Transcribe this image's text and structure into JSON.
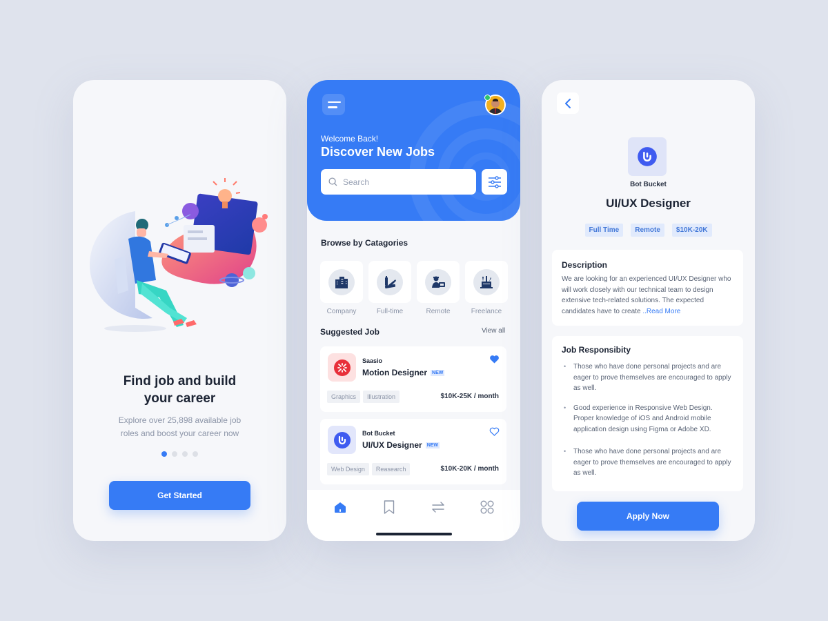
{
  "onboarding": {
    "title": "Find job and build your career",
    "subtitle": "Explore over 25,898 available job roles and boost your career now",
    "pagination": {
      "total": 4,
      "active": 1
    },
    "cta_label": "Get Started"
  },
  "home": {
    "welcome": "Welcome Back!",
    "heading": "Discover New Jobs",
    "search": {
      "placeholder": "Search",
      "value": ""
    },
    "categories_title": "Browse by Catagories",
    "categories": [
      {
        "label": "Company",
        "icon": "building-icon"
      },
      {
        "label": "Full-time",
        "icon": "tools-icon"
      },
      {
        "label": "Remote",
        "icon": "remote-worker-icon"
      },
      {
        "label": "Freelance",
        "icon": "pen-holder-icon"
      }
    ],
    "suggested_title": "Suggested Job",
    "view_all_label": "View all",
    "jobs": [
      {
        "company": "Saasio",
        "title": "Motion Designer",
        "badge": "NEW",
        "tags": [
          "Graphics",
          "Illustration"
        ],
        "salary": "$10K-25K / month",
        "favorited": true,
        "logo_color": "#e8303a",
        "logo_bg": "#fde1e1"
      },
      {
        "company": "Bot Bucket",
        "title": "UI/UX Designer",
        "badge": "NEW",
        "tags": [
          "Web Design",
          "Reasearch"
        ],
        "salary": "$10K-20K / month",
        "favorited": false,
        "logo_color": "#3f5bf0",
        "logo_bg": "#e2e6fb"
      }
    ],
    "nav": [
      {
        "name": "home",
        "icon": "home-icon",
        "active": true
      },
      {
        "name": "saved",
        "icon": "bookmark-icon",
        "active": false
      },
      {
        "name": "transfer",
        "icon": "swap-arrows-icon",
        "active": false
      },
      {
        "name": "more",
        "icon": "grid-icon",
        "active": false
      }
    ]
  },
  "detail": {
    "company": "Bot Bucket",
    "title": "UI/UX Designer",
    "tags": [
      "Full Time",
      "Remote",
      "$10K-20K"
    ],
    "description_title": "Description",
    "description": "We are looking for an experienced UI/UX Designer who will work closely with our technical team to design extensive tech-related solutions. The expected candidates have to create ",
    "read_more_label": "..Read More",
    "responsibility_title": "Job Responsibity",
    "responsibilities": [
      "Those who have done personal projects and are eager to prove themselves are encouraged to apply as well.",
      "Good experience in Responsive Web Design. Proper knowledge of iOS and Android mobile application design using Figma or Adobe XD.",
      "Those who have done personal projects and are eager to prove themselves are encouraged to apply as well."
    ],
    "cta_label": "Apply Now"
  },
  "colors": {
    "primary": "#367bf5",
    "background": "#dfe3ed",
    "card": "#f6f7fa",
    "text_dark": "#1c2434",
    "text_muted": "#8c95a8",
    "online": "#2ec46b"
  }
}
